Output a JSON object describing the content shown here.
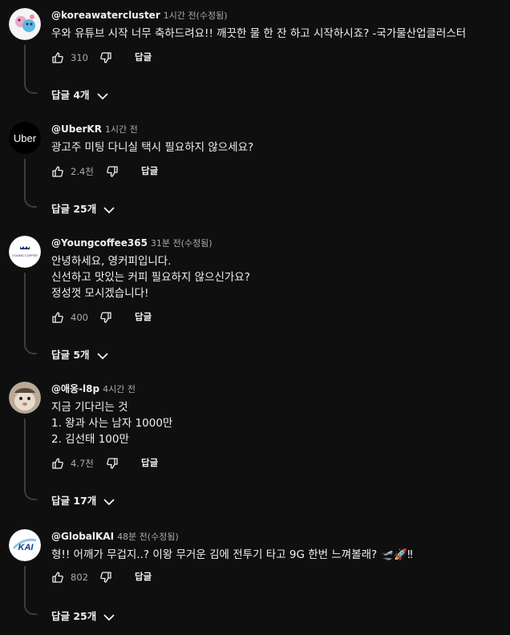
{
  "comments": [
    {
      "author": "@koreawatercluster",
      "time": "1시간 전(수정됨)",
      "lines": [
        "우와 유튜브 시작 너무 축하드려요!! 깨끗한 물 한 잔 하고 시작하시죠? -국가물산업클러스터"
      ],
      "likes": "310",
      "reply_label": "답글",
      "replies_label": "답글 4개"
    },
    {
      "author": "@UberKR",
      "time": "1시간 전",
      "lines": [
        "광고주 미팅 다니실 택시 필요하지 않으세요?"
      ],
      "likes": "2.4천",
      "reply_label": "답글",
      "replies_label": "답글 25개",
      "avatar_text": "Uber"
    },
    {
      "author": "@Youngcoffee365",
      "time": "31분 전(수정됨)",
      "lines": [
        "안녕하세요, 영커피입니다.",
        "신선하고 맛있는 커피 필요하지 않으신가요?",
        "정성껏 모시겠습니다!"
      ],
      "likes": "400",
      "reply_label": "답글",
      "replies_label": "답글 5개",
      "avatar_text": "YOUNG COFFEE"
    },
    {
      "author": "@애옹-l8p",
      "time": "4시간 전",
      "lines": [
        "지금 기다리는 것",
        "1. 왕과 사는 남자 1000만",
        "2. 김선태 100만"
      ],
      "likes": "4.7천",
      "reply_label": "답글",
      "replies_label": "답글 17개"
    },
    {
      "author": "@GlobalKAI",
      "time": "48분 전(수정됨)",
      "lines": [
        "형!! 어깨가 무겁지..? 이왕 무거운 김에 전투기 타고 9G 한번 느껴볼래? 🛫🚀‼"
      ],
      "likes": "802",
      "reply_label": "답글",
      "replies_label": "답글 25개",
      "avatar_text": "KAI"
    }
  ]
}
